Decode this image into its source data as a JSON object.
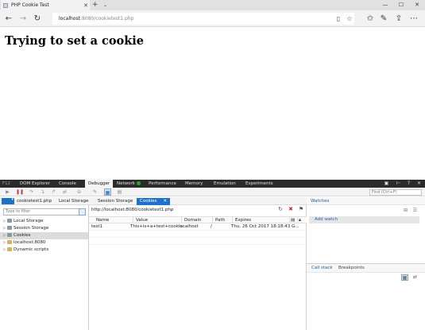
{
  "browser": {
    "tab_title": "PHP Cookie Test",
    "url_host": "localhost",
    "url_rest": ":8080/cookietest1.php"
  },
  "page": {
    "heading": "Trying to set a cookie"
  },
  "devtools": {
    "f12_label": "F12",
    "tabs": [
      "DOM Explorer",
      "Console",
      "Debugger",
      "Network",
      "Performance",
      "Memory",
      "Emulation",
      "Experiments"
    ],
    "active_tab": "Debugger",
    "find_placeholder": "Find (Ctrl+F)",
    "doc_tabs": [
      "cookietest1.php",
      "Local Storage",
      "Session Storage",
      "Cookies"
    ],
    "filter_placeholder": "Type to filter",
    "tree": [
      {
        "label": "Local Storage"
      },
      {
        "label": "Session Storage"
      },
      {
        "label": "Cookies"
      },
      {
        "label": "localhost:8080"
      },
      {
        "label": "Dynamic scripts"
      }
    ],
    "cookies": {
      "url": "http://localhost:8080/cookietest1.php",
      "columns": [
        "Name",
        "Value",
        "Domain",
        "Path",
        "Expires"
      ],
      "rows": [
        {
          "name": "test1",
          "value": "This+is+a+test+cookie",
          "domain": "localhost",
          "path": "/",
          "expires": "Thu, 26 Oct 2017 18:18:43 G..."
        }
      ]
    },
    "watches": {
      "title": "Watches",
      "add_watch": "Add watch"
    },
    "bottom_tabs": [
      "Call stack",
      "Breakpoints"
    ]
  }
}
